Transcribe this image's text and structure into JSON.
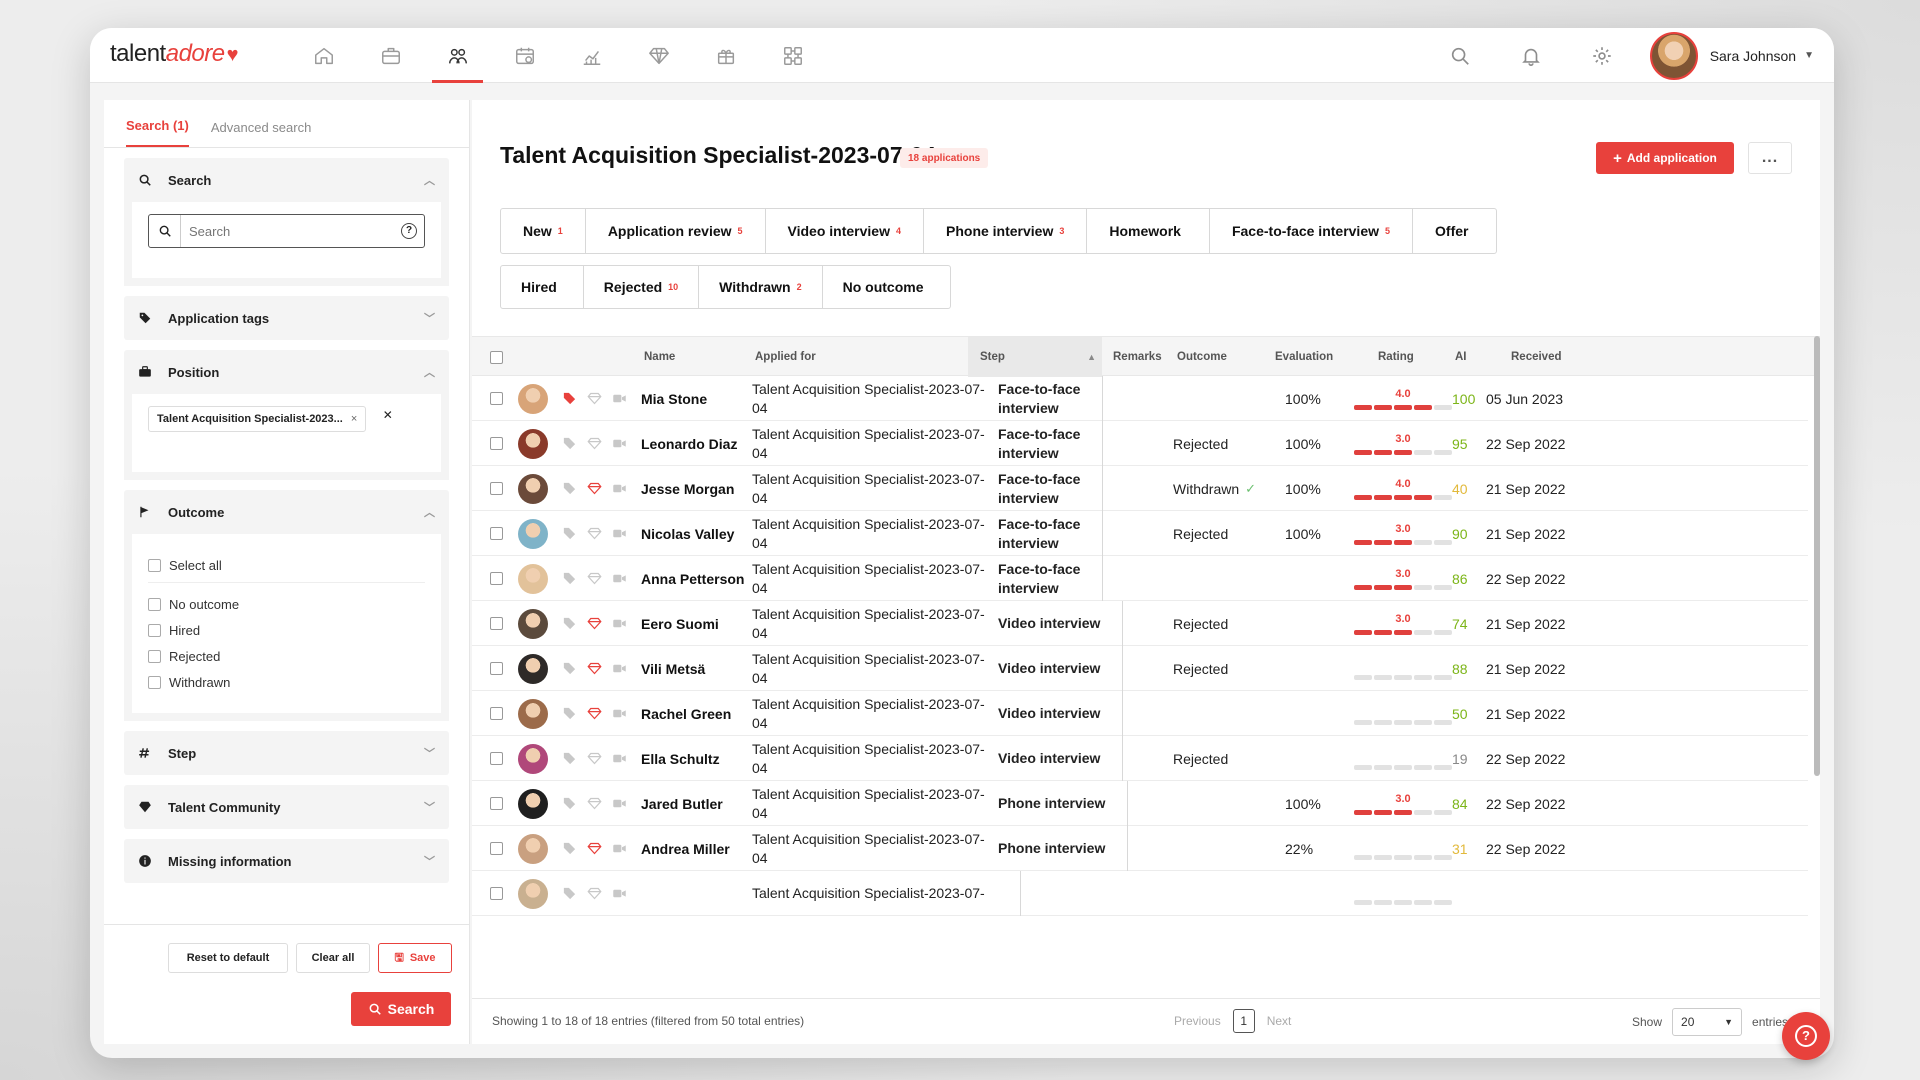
{
  "app": {
    "brand_text": "talent",
    "brand_accent": "adore",
    "accent_color": "#e8413c"
  },
  "topbar": {
    "nav_icons": [
      "home-icon",
      "briefcase-icon",
      "people-icon",
      "calendar-icon",
      "analytics-icon",
      "diamond-icon",
      "gift-icon",
      "integrations-icon"
    ],
    "active_index": 2,
    "user_name": "Sara Johnson"
  },
  "sidebar": {
    "tabs": [
      "Search (1)",
      "Advanced search"
    ],
    "search": {
      "title": "Search",
      "placeholder": "Search"
    },
    "application_tags": {
      "title": "Application tags"
    },
    "position": {
      "title": "Position",
      "chip": "Talent Acquisition Specialist-2023..."
    },
    "outcome": {
      "title": "Outcome",
      "select_all": "Select all",
      "options": [
        "No outcome",
        "Hired",
        "Rejected",
        "Withdrawn"
      ]
    },
    "step": {
      "title": "Step"
    },
    "talent_community": {
      "title": "Talent Community"
    },
    "missing_information": {
      "title": "Missing information"
    },
    "footer": {
      "reset": "Reset to default",
      "clear": "Clear all",
      "save": "Save",
      "search": "Search"
    }
  },
  "main": {
    "title": "Talent Acquisition Specialist-2023-07-04",
    "applications_badge": "18 applications",
    "add_button": "Add application",
    "more_button": "...",
    "steps": [
      {
        "label": "New",
        "count": "1"
      },
      {
        "label": "Application review",
        "count": "5"
      },
      {
        "label": "Video interview",
        "count": "4"
      },
      {
        "label": "Phone interview",
        "count": "3"
      },
      {
        "label": "Homework",
        "count": ""
      },
      {
        "label": "Face-to-face interview",
        "count": "5"
      },
      {
        "label": "Offer",
        "count": ""
      }
    ],
    "outcomes": [
      {
        "label": "Hired",
        "count": ""
      },
      {
        "label": "Rejected",
        "count": "10"
      },
      {
        "label": "Withdrawn",
        "count": "2"
      },
      {
        "label": "No outcome",
        "count": ""
      }
    ],
    "columns": [
      "Name",
      "Applied for",
      "Step",
      "Remarks",
      "Outcome",
      "Evaluation",
      "Rating",
      "AI",
      "Received"
    ],
    "rows": [
      {
        "name": "Mia Stone",
        "applied_1": "Talent Acquisition Specialist-2023-07-",
        "applied_2": "04",
        "step_1": "Face-to-face",
        "step_2": "interview",
        "outcome": "",
        "evaluation": "100%",
        "rating": "4.0",
        "rating_frac": 0.8,
        "ai": "100",
        "ai_color": "#7cb518",
        "received": "05 Jun 2023",
        "tag_red": true,
        "diamond_red": false
      },
      {
        "name": "Leonardo Diaz",
        "applied_1": "Talent Acquisition Specialist-2023-07-",
        "applied_2": "04",
        "step_1": "Face-to-face",
        "step_2": "interview",
        "outcome": "Rejected",
        "evaluation": "100%",
        "rating": "3.0",
        "rating_frac": 0.6,
        "ai": "95",
        "ai_color": "#7cb518",
        "received": "22 Sep 2022",
        "tag_red": false,
        "diamond_red": false
      },
      {
        "name": "Jesse Morgan",
        "applied_1": "Talent Acquisition Specialist-2023-07-",
        "applied_2": "04",
        "step_1": "Face-to-face",
        "step_2": "interview",
        "outcome": "Withdrawn",
        "evaluation": "100%",
        "rating": "4.0",
        "rating_frac": 0.8,
        "ai": "40",
        "ai_color": "#e2b93b",
        "received": "21 Sep 2022",
        "tag_red": false,
        "diamond_red": true
      },
      {
        "name": "Nicolas Valley",
        "applied_1": "Talent Acquisition Specialist-2023-07-",
        "applied_2": "04",
        "step_1": "Face-to-face",
        "step_2": "interview",
        "outcome": "Rejected",
        "evaluation": "100%",
        "rating": "3.0",
        "rating_frac": 0.6,
        "ai": "90",
        "ai_color": "#7cb518",
        "received": "21 Sep 2022",
        "tag_red": false,
        "diamond_red": false
      },
      {
        "name": "Anna Petterson",
        "applied_1": "Talent Acquisition Specialist-2023-07-",
        "applied_2": "04",
        "step_1": "Face-to-face",
        "step_2": "interview",
        "outcome": "",
        "evaluation": "",
        "rating": "3.0",
        "rating_frac": 0.6,
        "ai": "86",
        "ai_color": "#7cb518",
        "received": "22 Sep 2022",
        "tag_red": false,
        "diamond_red": false
      },
      {
        "name": "Eero Suomi",
        "applied_1": "Talent Acquisition Specialist-2023-07-",
        "applied_2": "04",
        "step_1": "Video interview",
        "step_2": "",
        "outcome": "Rejected",
        "evaluation": "",
        "rating": "3.0",
        "rating_frac": 0.6,
        "ai": "74",
        "ai_color": "#7cb518",
        "received": "21 Sep 2022",
        "tag_red": false,
        "diamond_red": true
      },
      {
        "name": "Vili Metsä",
        "applied_1": "Talent Acquisition Specialist-2023-07-",
        "applied_2": "04",
        "step_1": "Video interview",
        "step_2": "",
        "outcome": "Rejected",
        "evaluation": "",
        "rating": "",
        "rating_frac": 0,
        "ai": "88",
        "ai_color": "#7cb518",
        "received": "21 Sep 2022",
        "tag_red": false,
        "diamond_red": true
      },
      {
        "name": "Rachel Green",
        "applied_1": "Talent Acquisition Specialist-2023-07-",
        "applied_2": "04",
        "step_1": "Video interview",
        "step_2": "",
        "outcome": "",
        "evaluation": "",
        "rating": "",
        "rating_frac": 0,
        "ai": "50",
        "ai_color": "#7cb518",
        "received": "21 Sep 2022",
        "tag_red": false,
        "diamond_red": true
      },
      {
        "name": "Ella Schultz",
        "applied_1": "Talent Acquisition Specialist-2023-07-",
        "applied_2": "04",
        "step_1": "Video interview",
        "step_2": "",
        "outcome": "Rejected",
        "evaluation": "",
        "rating": "",
        "rating_frac": 0,
        "ai": "19",
        "ai_color": "#888888",
        "received": "22 Sep 2022",
        "tag_red": false,
        "diamond_red": false
      },
      {
        "name": "Jared Butler",
        "applied_1": "Talent Acquisition Specialist-2023-07-",
        "applied_2": "04",
        "step_1": "Phone interview",
        "step_2": "",
        "outcome": "",
        "evaluation": "100%",
        "rating": "3.0",
        "rating_frac": 0.6,
        "ai": "84",
        "ai_color": "#7cb518",
        "received": "22 Sep 2022",
        "tag_red": false,
        "diamond_red": false
      },
      {
        "name": "Andrea Miller",
        "applied_1": "Talent Acquisition Specialist-2023-07-",
        "applied_2": "04",
        "step_1": "Phone interview",
        "step_2": "",
        "outcome": "",
        "evaluation": "22%",
        "rating": "",
        "rating_frac": 0,
        "ai": "31",
        "ai_color": "#e2b93b",
        "received": "22 Sep 2022",
        "tag_red": false,
        "diamond_red": true
      },
      {
        "name": "",
        "applied_1": "Talent Acquisition Specialist-2023-07-",
        "applied_2": "",
        "step_1": "",
        "step_2": "",
        "outcome": "",
        "evaluation": "",
        "rating": "",
        "rating_frac": 0,
        "ai": "",
        "ai_color": "#7cb518",
        "received": "",
        "tag_red": false,
        "diamond_red": false
      }
    ],
    "footer": {
      "info": "Showing 1 to 18 of 18 entries (filtered from 50 total entries)",
      "previous": "Previous",
      "page": "1",
      "next": "Next",
      "show_label": "Show",
      "page_size": "20",
      "entries_label": "entries"
    }
  }
}
